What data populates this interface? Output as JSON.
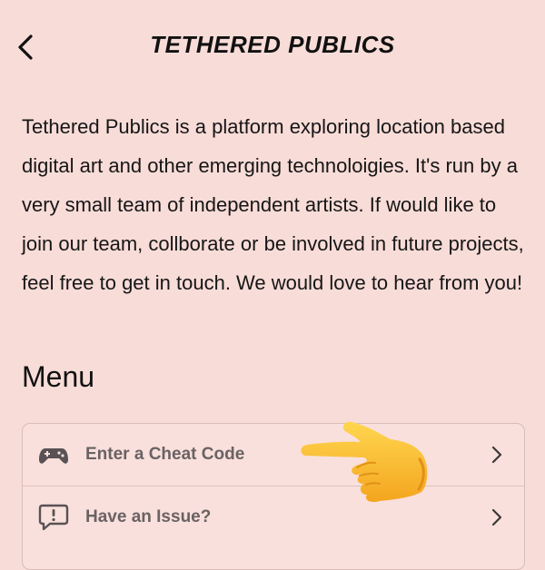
{
  "header": {
    "back_icon": "chevron-left-icon",
    "title": "TETHERED PUBLICS"
  },
  "intro": {
    "text": "Tethered Publics is a platform exploring location based digital art and other emerging technoloigies. It's run by a very small team of independent artists. If would like to join our team, collborate or be involved in future projects, feel free to get in touch. We would love to hear from you!"
  },
  "menu": {
    "heading": "Menu",
    "items": [
      {
        "label": "Enter a Cheat Code",
        "icon": "gamepad-icon"
      },
      {
        "label": "Have an Issue?",
        "icon": "speech-bubble-exclamation-icon"
      }
    ]
  },
  "overlay": {
    "emoji": "backhand-index-pointing-right"
  },
  "colors": {
    "background": "#f8dcd8",
    "card": "#f9e0dc",
    "border": "#d9bcb8",
    "menu_text": "#6a6263",
    "emoji": "#ffc83d"
  }
}
